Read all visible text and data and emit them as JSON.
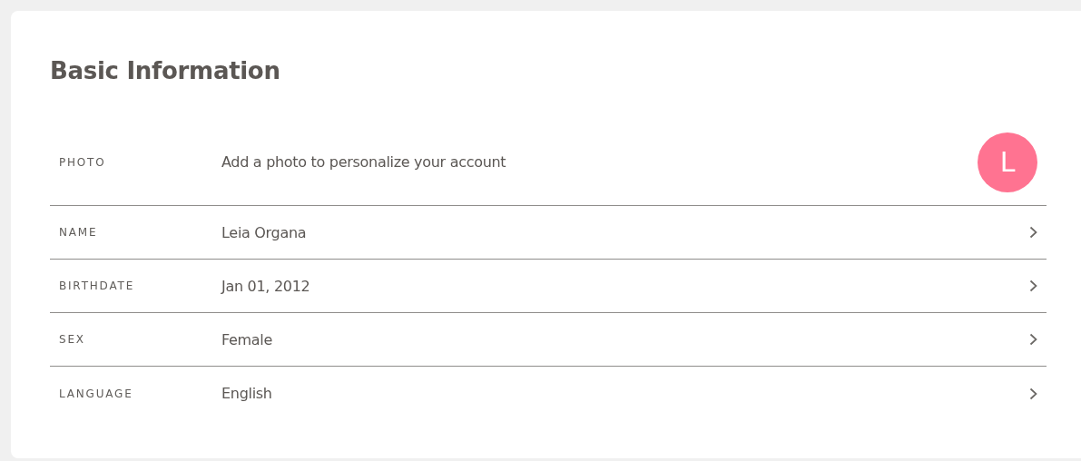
{
  "title": "Basic Information",
  "rows": [
    {
      "kind": "photo",
      "label": "PHOTO",
      "value": "Add a photo to personalize your account",
      "avatar": "L"
    },
    {
      "kind": "field",
      "label": "NAME",
      "value": "Leia Organa"
    },
    {
      "kind": "field",
      "label": "BIRTHDATE",
      "value": "Jan 01, 2012"
    },
    {
      "kind": "field",
      "label": "SEX",
      "value": "Female"
    },
    {
      "kind": "field",
      "label": "LANGUAGE",
      "value": "English"
    }
  ]
}
